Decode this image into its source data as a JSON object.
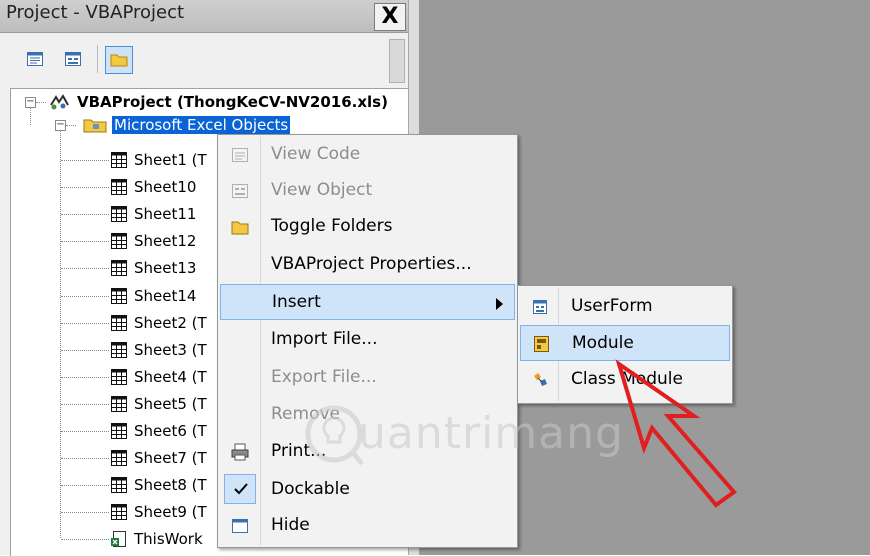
{
  "window": {
    "title": "Project - VBAProject",
    "close_label": "X"
  },
  "toolbar": {
    "buttons": [
      {
        "name": "view-code-icon"
      },
      {
        "name": "view-object-icon"
      },
      {
        "name": "toggle-folders-icon"
      }
    ]
  },
  "tree": {
    "project_label": "VBAProject (ThongKeCV-NV2016.xls)",
    "folder_label": "Microsoft Excel Objects",
    "expander_minus": "−",
    "items": [
      {
        "label": "Sheet1 (T"
      },
      {
        "label": "Sheet10"
      },
      {
        "label": "Sheet11"
      },
      {
        "label": "Sheet12"
      },
      {
        "label": "Sheet13"
      },
      {
        "label": "Sheet14"
      },
      {
        "label": "Sheet2 (T"
      },
      {
        "label": "Sheet3 (T"
      },
      {
        "label": "Sheet4 (T"
      },
      {
        "label": "Sheet5 (T"
      },
      {
        "label": "Sheet6 (T"
      },
      {
        "label": "Sheet7 (T"
      },
      {
        "label": "Sheet8 (T"
      },
      {
        "label": "Sheet9 (T"
      },
      {
        "label": "ThisWork"
      }
    ]
  },
  "context_menu": {
    "items": [
      {
        "label": "View Code",
        "disabled": true
      },
      {
        "label": "View Object",
        "disabled": true
      },
      {
        "label": "Toggle Folders",
        "disabled": false
      },
      {
        "label": "VBAProject Properties...",
        "disabled": false
      },
      {
        "label": "Insert",
        "disabled": false,
        "highlighted": true
      },
      {
        "label": "Import File...",
        "disabled": false
      },
      {
        "label": "Export File...",
        "disabled": true
      },
      {
        "label": "Remove",
        "disabled": true
      },
      {
        "label": "Print...",
        "disabled": false
      },
      {
        "label": "Dockable",
        "disabled": false,
        "checked": true
      },
      {
        "label": "Hide",
        "disabled": false
      }
    ]
  },
  "insert_submenu": {
    "items": [
      {
        "label": "UserForm"
      },
      {
        "label": "Module",
        "highlighted": true
      },
      {
        "label": "Class Module"
      }
    ]
  },
  "watermark": {
    "text": "uantrimang"
  },
  "colors": {
    "highlight": "#cfe4f8",
    "highlight_border": "#7eb4ea",
    "selection": "#0a64d6",
    "annotation_arrow": "#e02020"
  }
}
